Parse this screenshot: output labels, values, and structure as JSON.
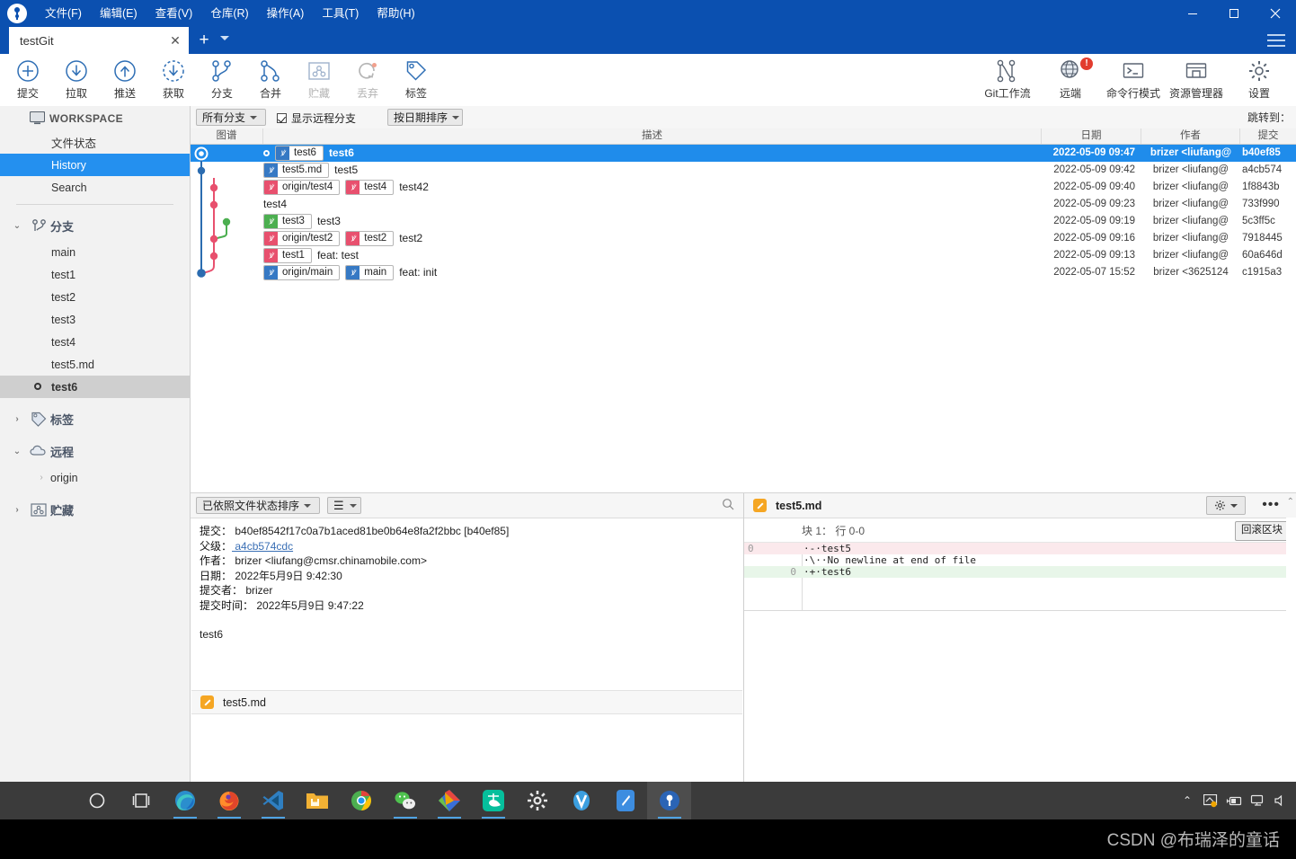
{
  "window": {
    "title": "testGit",
    "minimize": "—",
    "maximize": "☐",
    "close": "✕"
  },
  "menu": [
    {
      "label": "文件(F)",
      "name": "menu-file"
    },
    {
      "label": "编辑(E)",
      "name": "menu-edit"
    },
    {
      "label": "查看(V)",
      "name": "menu-view"
    },
    {
      "label": "仓库(R)",
      "name": "menu-repository"
    },
    {
      "label": "操作(A)",
      "name": "menu-actions"
    },
    {
      "label": "工具(T)",
      "name": "menu-tools"
    },
    {
      "label": "帮助(H)",
      "name": "menu-help"
    }
  ],
  "tab": {
    "label": "testGit",
    "close": "✕",
    "add": "+"
  },
  "toolbar": {
    "left": [
      {
        "label": "提交",
        "icon": "commit-plus-icon",
        "disabled": false
      },
      {
        "label": "拉取",
        "icon": "pull-down-arrow-icon",
        "disabled": false
      },
      {
        "label": "推送",
        "icon": "push-up-arrow-icon",
        "disabled": false
      },
      {
        "label": "获取",
        "icon": "fetch-dashed-arrow-icon",
        "disabled": false
      },
      {
        "label": "分支",
        "icon": "branch-icon",
        "disabled": false
      },
      {
        "label": "合并",
        "icon": "merge-icon",
        "disabled": false
      },
      {
        "label": "贮藏",
        "icon": "stash-icon",
        "disabled": true
      },
      {
        "label": "丢弃",
        "icon": "discard-icon",
        "disabled": true
      },
      {
        "label": "标签",
        "icon": "tag-icon",
        "disabled": false
      }
    ],
    "right": [
      {
        "label": "Git工作流",
        "icon": "gitflow-icon",
        "badge": ""
      },
      {
        "label": "远端",
        "icon": "remote-globe-icon",
        "badge": "!"
      },
      {
        "label": "命令行模式",
        "icon": "terminal-icon",
        "badge": ""
      },
      {
        "label": "资源管理器",
        "icon": "explorer-folder-icon",
        "badge": ""
      },
      {
        "label": "设置",
        "icon": "gear-icon",
        "badge": ""
      }
    ]
  },
  "sidebar": {
    "workspace_label": "WORKSPACE",
    "workspace_items": [
      {
        "label": "文件状态",
        "selected": false
      },
      {
        "label": "History",
        "selected": true
      },
      {
        "label": "Search",
        "selected": false
      }
    ],
    "branches": {
      "label": "分支",
      "expanded": true,
      "chevron": "⌄",
      "items": [
        {
          "label": "main",
          "current": false
        },
        {
          "label": "test1",
          "current": false
        },
        {
          "label": "test2",
          "current": false
        },
        {
          "label": "test3",
          "current": false
        },
        {
          "label": "test4",
          "current": false
        },
        {
          "label": "test5.md",
          "current": false
        },
        {
          "label": "test6",
          "current": true
        }
      ]
    },
    "tags": {
      "label": "标签",
      "expanded": false,
      "chevron": "›"
    },
    "remotes": {
      "label": "远程",
      "expanded": true,
      "chevron": "⌄",
      "items": [
        {
          "label": "origin",
          "chevron": "›"
        }
      ]
    },
    "stashes": {
      "label": "贮藏",
      "expanded": false,
      "chevron": "›"
    }
  },
  "filterbar": {
    "branch_filter": "所有分支",
    "show_remote_branches": "显示远程分支",
    "show_remote_checked": true,
    "sort_order": "按日期排序",
    "jump_to": "跳转到："
  },
  "commit_table": {
    "columns": [
      "图谱",
      "描述",
      "日期",
      "作者",
      "提交"
    ],
    "rows": [
      {
        "selected": true,
        "head": true,
        "refs": [
          {
            "text": "test6",
            "color": "blue"
          }
        ],
        "message": "test6",
        "date": "2022-05-09 09:47",
        "author": "brizer <liufang@",
        "hash": "b40ef85"
      },
      {
        "selected": false,
        "head": false,
        "refs": [
          {
            "text": "test5.md",
            "color": "blue"
          }
        ],
        "message": "test5",
        "date": "2022-05-09 09:42",
        "author": "brizer <liufang@",
        "hash": "a4cb574"
      },
      {
        "selected": false,
        "head": false,
        "refs": [
          {
            "text": "origin/test4",
            "color": "red"
          },
          {
            "text": "test4",
            "color": "red"
          }
        ],
        "message": "test42",
        "date": "2022-05-09 09:40",
        "author": "brizer <liufang@",
        "hash": "1f8843b"
      },
      {
        "selected": false,
        "head": false,
        "refs": [],
        "message": "test4",
        "date": "2022-05-09 09:23",
        "author": "brizer <liufang@",
        "hash": "733f990"
      },
      {
        "selected": false,
        "head": false,
        "refs": [
          {
            "text": "test3",
            "color": "green"
          }
        ],
        "message": "test3",
        "date": "2022-05-09 09:19",
        "author": "brizer <liufang@",
        "hash": "5c3ff5c"
      },
      {
        "selected": false,
        "head": false,
        "refs": [
          {
            "text": "origin/test2",
            "color": "red"
          },
          {
            "text": "test2",
            "color": "red"
          }
        ],
        "message": "test2",
        "date": "2022-05-09 09:16",
        "author": "brizer <liufang@",
        "hash": "7918445"
      },
      {
        "selected": false,
        "head": false,
        "refs": [
          {
            "text": "test1",
            "color": "red"
          }
        ],
        "message": "feat: test",
        "date": "2022-05-09 09:13",
        "author": "brizer <liufang@",
        "hash": "60a646d"
      },
      {
        "selected": false,
        "head": false,
        "refs": [
          {
            "text": "origin/main",
            "color": "blue"
          },
          {
            "text": "main",
            "color": "blue"
          }
        ],
        "message": "feat: init",
        "date": "2022-05-07 15:52",
        "author": "brizer <3625124",
        "hash": "c1915a3"
      }
    ]
  },
  "detail_panel": {
    "sort_label": "已依照文件状态排序",
    "view_label": "☰",
    "search_icon": "search-icon",
    "lines": [
      {
        "key": "提交：",
        "value": "b40ef8542f17c0a7b1aced81be0b64e8fa2f2bbc [b40ef85]",
        "link": false
      },
      {
        "key": "父级：",
        "value": "a4cb574cdc",
        "link": true
      },
      {
        "key": "作者：",
        "value": "brizer <liufang@cmsr.chinamobile.com>",
        "link": false
      },
      {
        "key": "日期：",
        "value": "2022年5月9日 9:42:30",
        "link": false
      },
      {
        "key": "提交者：",
        "value": "brizer",
        "link": false
      },
      {
        "key": "提交时间：",
        "value": "2022年5月9日 9:47:22",
        "link": false
      }
    ],
    "message": "test6",
    "files": [
      {
        "name": "test5.md",
        "icon": "edit-file-icon"
      }
    ]
  },
  "diff_panel": {
    "filename": "test5.md",
    "file_icon": "edit-file-icon",
    "gear_icon": "gear-icon",
    "more_icon": "more-dots-icon",
    "hunk_label": "块 1： 行 0-0",
    "rollback_label": "回滚区块",
    "lines": [
      {
        "old": "0",
        "new": "",
        "text": "·-·test5",
        "type": "minus"
      },
      {
        "old": "",
        "new": "",
        "text": "·\\··No newline at end of file",
        "type": "context"
      },
      {
        "old": "",
        "new": "0",
        "text": "·+·test6",
        "type": "plus"
      }
    ]
  },
  "taskbar": {
    "items": [
      {
        "name": "cortana-search",
        "glyph": "○",
        "active": false,
        "underline": false
      },
      {
        "name": "task-view",
        "glyph": "❏",
        "active": false,
        "underline": false
      },
      {
        "name": "edge",
        "glyph": "",
        "active": false,
        "underline": true
      },
      {
        "name": "firefox",
        "glyph": "",
        "active": false,
        "underline": true
      },
      {
        "name": "vscode",
        "glyph": "",
        "active": false,
        "underline": true
      },
      {
        "name": "file-explorer",
        "glyph": "",
        "active": false,
        "underline": false
      },
      {
        "name": "chrome",
        "glyph": "",
        "active": false,
        "underline": false
      },
      {
        "name": "wechat",
        "glyph": "",
        "active": false,
        "underline": true
      },
      {
        "name": "beyond-compare",
        "glyph": "",
        "active": false,
        "underline": true
      },
      {
        "name": "alipay",
        "glyph": "",
        "active": false,
        "underline": true
      },
      {
        "name": "settings",
        "glyph": "✿",
        "active": false,
        "underline": false
      },
      {
        "name": "vysor",
        "glyph": "V",
        "active": false,
        "underline": false
      },
      {
        "name": "typora",
        "glyph": "",
        "active": false,
        "underline": false
      },
      {
        "name": "sourcetree",
        "glyph": "",
        "active": true,
        "underline": true
      }
    ],
    "tray": [
      "⌃",
      "display",
      "battery",
      "network"
    ]
  },
  "watermark": "CSDN @布瑞泽的童话",
  "colors": {
    "title_blue": "#0b50b0",
    "selection_blue": "#1f8ceb",
    "sidebar_sel": "#2490ef",
    "ref_blue": "#3679c4",
    "ref_red": "#e8506e",
    "ref_green": "#4caf50",
    "badge_red": "#e23c2e",
    "diff_minus": "#fbe9ec",
    "diff_plus": "#e8f6e9"
  }
}
